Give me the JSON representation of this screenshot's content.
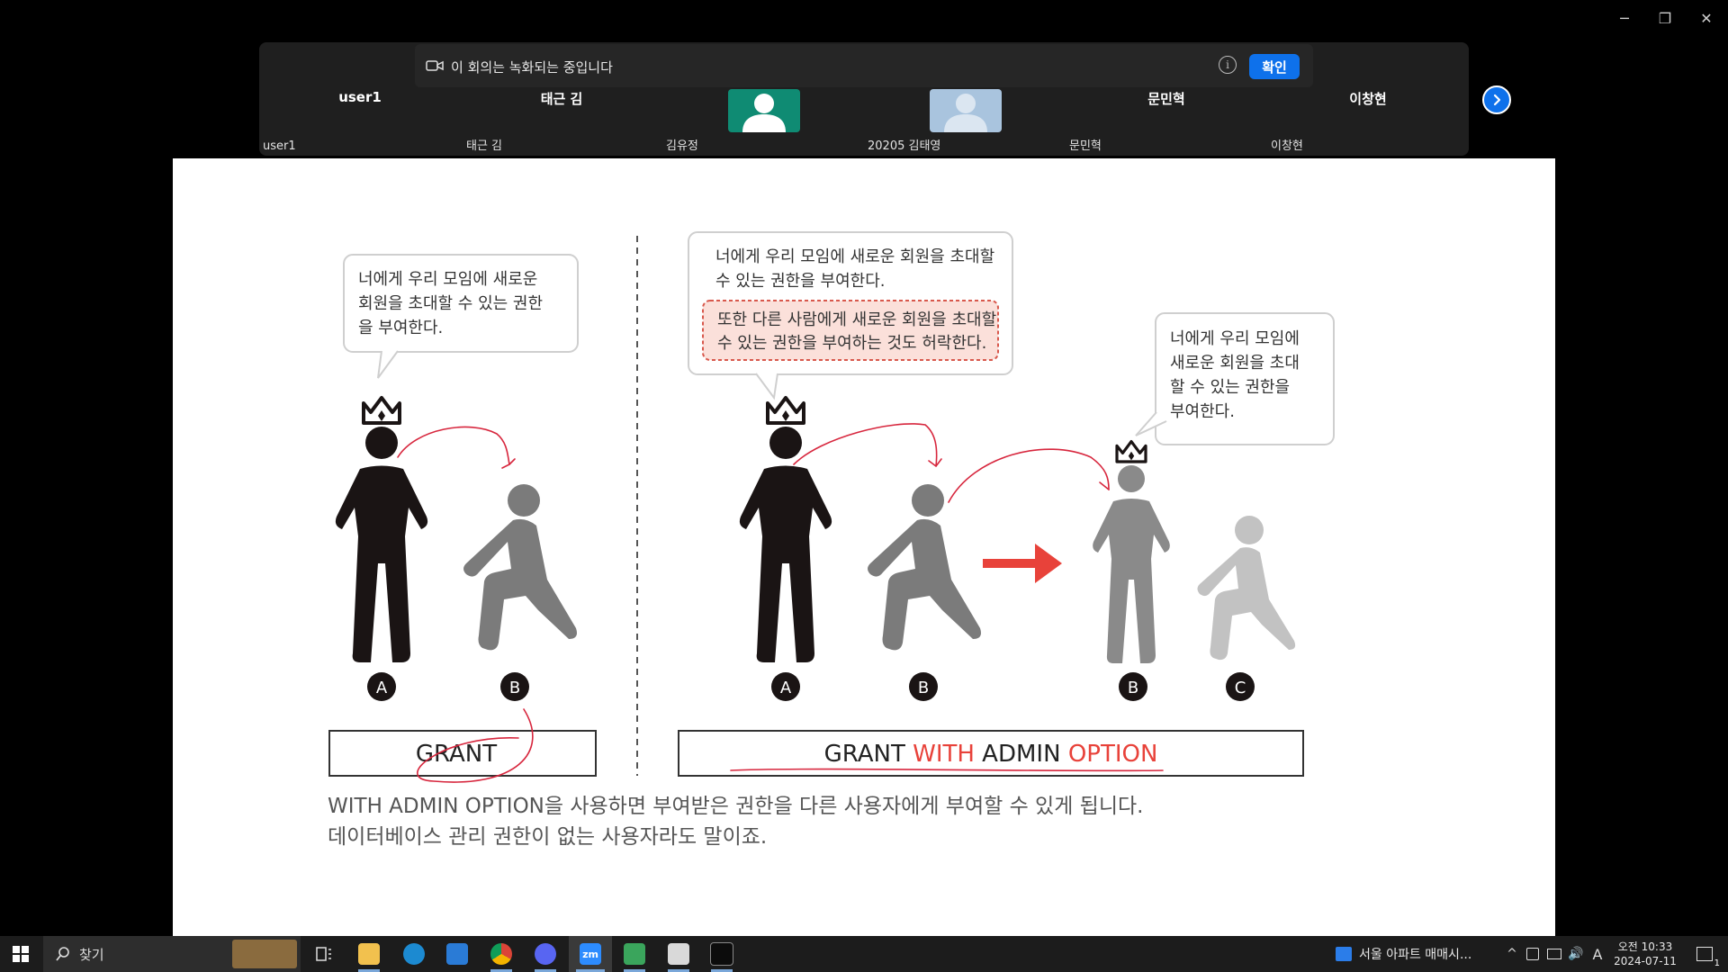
{
  "window": {
    "minimize": "─",
    "restore": "❐",
    "close": "✕"
  },
  "banner": {
    "text": "이 회의는 녹화되는 중입니다",
    "info_icon": "info-icon",
    "confirm_label": "확인"
  },
  "participants": [
    {
      "name": "user1",
      "label": "user1"
    },
    {
      "name": "태근 김",
      "label": "태근 김"
    },
    {
      "name": "",
      "label": "김유정"
    },
    {
      "name": "",
      "label": "20205 김태영"
    },
    {
      "name": "문민혁",
      "label": "문민혁"
    },
    {
      "name": "이창현",
      "label": "이창현"
    }
  ],
  "slide": {
    "left_bubble": "너에게 우리 모임에 새로운 회원을 초대할 수 있는 권한을 부여한다.",
    "mid_bubble_1": "너에게 우리 모임에 새로운 회원을 초대할 수 있는 권한을 부여한다.",
    "mid_bubble_2": "또한 다른 사람에게 새로운 회원을 초대할 수 있는 권한을 부여하는 것도 허락한다.",
    "right_bubble": "너에게 우리 모임에 새로운 회원을 초대할 수 있는 권한을 부여한다.",
    "grant_label": "GRANT",
    "grant_admin": {
      "p1": "GRANT ",
      "p2": "WITH",
      "p3": " ADMIN ",
      "p4": "OPTION"
    },
    "badges": {
      "a1": "A",
      "b1": "B",
      "a2": "A",
      "b2": "B",
      "b3": "B",
      "c": "C"
    },
    "caption_1": "WITH ADMIN OPTION을 사용하면 부여받은 권한을 다른 사용자에게 부여할 수 있게 됩니다.",
    "caption_2": "데이터베이스 관리 권한이 없는 사용자라도 말이죠."
  },
  "taskbar": {
    "search_label": "찾기",
    "news": "서울 아파트 매매시...",
    "time": "오전 10:33",
    "date": "2024-07-11",
    "ime": "A",
    "notifications": "1"
  },
  "colors": {
    "accent": "#0e71eb",
    "red": "#e8423a",
    "pink_box": "#fbe0da"
  }
}
